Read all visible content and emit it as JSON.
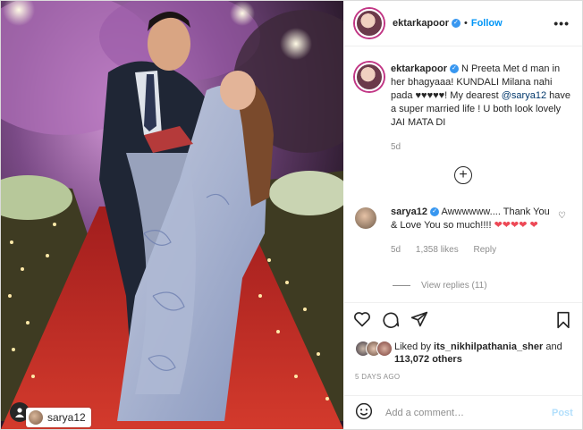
{
  "post": {
    "username": "ektarkapoor",
    "follow_label": "Follow",
    "separator": "•",
    "more_label": "•••",
    "photo_tag": "sarya12"
  },
  "caption": {
    "username": "ektarkapoor",
    "text_1": "N Preeta Met d man in her bhagyaaa! KUNDALI Milana nahi pada ♥♥♥♥♥! My dearest ",
    "mention": "@sarya12",
    "text_2": " have a super married life ! U both look lovely JAI MATA DI",
    "age": "5d"
  },
  "reply": {
    "username": "sarya12",
    "text": "Awwwwww.... Thank You & Love You so much!!!!",
    "hearts": "❤❤❤❤ ❤",
    "age": "5d",
    "likes": "1,358 likes",
    "reply_label": "Reply",
    "view_replies": "View replies (11)"
  },
  "likes": {
    "prefix": "Liked by ",
    "user": "its_nikhilpathania_sher",
    "middle": " and ",
    "others": "113,072 others"
  },
  "timestamp": "5 DAYS AGO",
  "comment_box": {
    "placeholder": "Add a comment…",
    "post_label": "Post"
  },
  "colors": {
    "accent": "#0095f6",
    "verified": "#3897f0",
    "heart": "#ed4956",
    "muted": "#8e8e8e"
  }
}
